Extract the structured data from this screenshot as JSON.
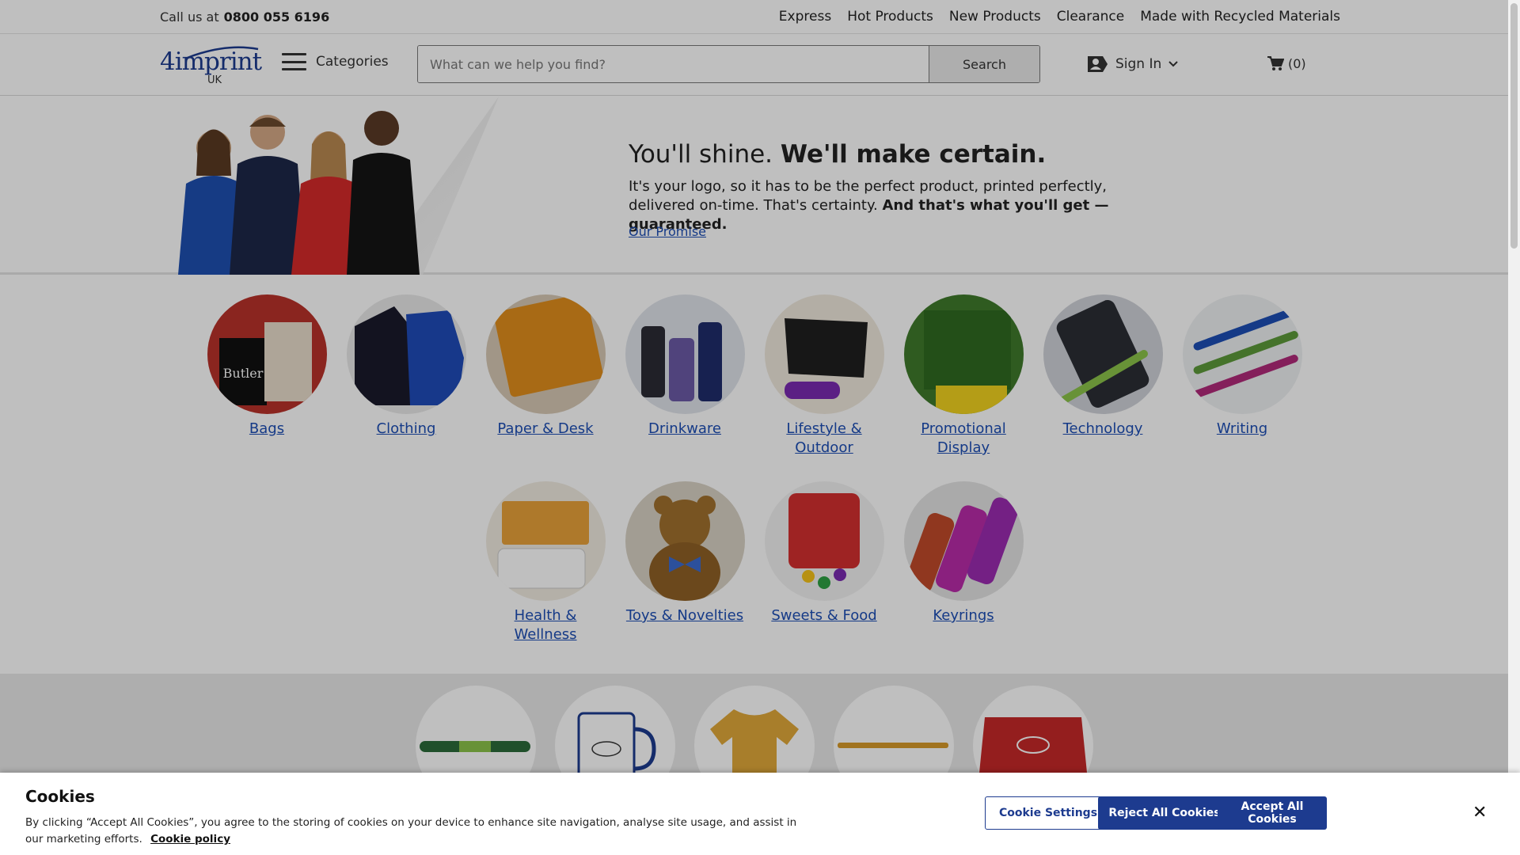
{
  "utility_bar": {
    "call_label": "Call us at",
    "phone": "0800 055 6196",
    "links": [
      "Express",
      "Hot Products",
      "New Products",
      "Clearance",
      "Made with Recycled Materials"
    ]
  },
  "header": {
    "logo_text": "4imprint",
    "logo_region": "UK",
    "categories_label": "Categories",
    "search_placeholder": "What can we help you find?",
    "search_button": "Search",
    "sign_in": "Sign In",
    "cart_count": "(0)"
  },
  "hero": {
    "headline_plain": "You'll shine.",
    "headline_bold": "We'll make certain.",
    "body_plain": "It's your logo, so it has to be the perfect product, printed perfectly, delivered on-time. That's certainty.",
    "body_bold": "And that's what you'll get — guaranteed.",
    "link": "Our Promise"
  },
  "categories": [
    {
      "label": "Bags",
      "color": "#b8322a"
    },
    {
      "label": "Clothing",
      "color": "#1f2b6b"
    },
    {
      "label": "Paper & Desk",
      "color": "#e08e1c"
    },
    {
      "label": "Drinkware",
      "color": "#9aa0a8"
    },
    {
      "label": "Lifestyle & Outdoor",
      "color": "#2b2b2b"
    },
    {
      "label": "Promotional Display",
      "color": "#3f7a2b"
    },
    {
      "label": "Technology",
      "color": "#7c8089"
    },
    {
      "label": "Writing",
      "color": "#5c9a3a"
    },
    {
      "label": "Health & Wellness",
      "color": "#e8a23a"
    },
    {
      "label": "Toys & Novelties",
      "color": "#a0702e"
    },
    {
      "label": "Sweets & Food",
      "color": "#d32f2f"
    },
    {
      "label": "Keyrings",
      "color": "#b92ba8"
    }
  ],
  "cookie": {
    "title": "Cookies",
    "text": "By clicking “Accept All Cookies”, you agree to the storing of cookies on your device to enhance site navigation, analyse site usage, and assist in our marketing efforts.",
    "policy_link": "Cookie policy",
    "settings_button": "Cookie Settings",
    "reject_button": "Reject All Cookies",
    "accept_button": "Accept All Cookies",
    "close_icon": "close-icon"
  }
}
